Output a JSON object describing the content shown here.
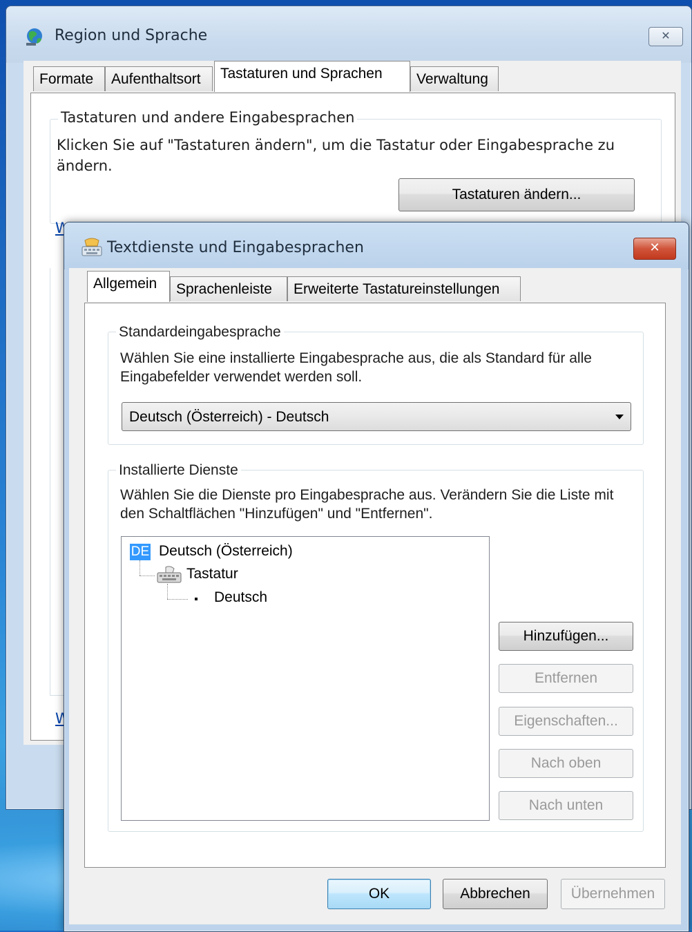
{
  "outer_window": {
    "title": "Region und Sprache",
    "close_glyph": "✕",
    "tabs": [
      {
        "label": "Formate"
      },
      {
        "label": "Aufenthaltsort"
      },
      {
        "label": "Tastaturen und Sprachen"
      },
      {
        "label": "Verwaltung"
      }
    ],
    "active_tab": "Tastaturen und Sprachen",
    "keyboards_group": {
      "caption": "Tastaturen und andere Eingabesprachen",
      "text": "Klicken Sie auf \"Tastaturen ändern\", um die Tastatur oder Eingabesprache zu ändern.",
      "button": "Tastaturen ändern..."
    },
    "partial_link_1": "W",
    "partial_link_2": "W"
  },
  "dialog": {
    "title": "Textdienste und Eingabesprachen",
    "close_glyph": "✕",
    "tabs": [
      {
        "label": "Allgemein"
      },
      {
        "label": "Sprachenleiste"
      },
      {
        "label": "Erweiterte Tastatureinstellungen"
      }
    ],
    "active_tab": "Allgemein",
    "default_language": {
      "caption": "Standardeingabesprache",
      "text": "Wählen Sie eine installierte Eingabesprache aus, die als Standard für alle Eingabefelder verwendet werden soll.",
      "selected": "Deutsch (Österreich) - Deutsch"
    },
    "installed_services": {
      "caption": "Installierte Dienste",
      "text": "Wählen Sie die Dienste pro Eingabesprache aus. Verändern Sie die Liste mit den Schaltflächen \"Hinzufügen\" und \"Entfernen\".",
      "tree": {
        "badge": "DE",
        "language": "Deutsch (Österreich)",
        "category": "Tastatur",
        "layout": "Deutsch"
      },
      "buttons": {
        "add": "Hinzufügen...",
        "remove": "Entfernen",
        "properties": "Eigenschaften...",
        "move_up": "Nach oben",
        "move_down": "Nach unten"
      }
    },
    "footer": {
      "ok": "OK",
      "cancel": "Abbrechen",
      "apply": "Übernehmen"
    }
  },
  "colors": {
    "selection": "#3399ff",
    "close_red": "#c23a1f",
    "title_bar": "#c9dcef"
  }
}
